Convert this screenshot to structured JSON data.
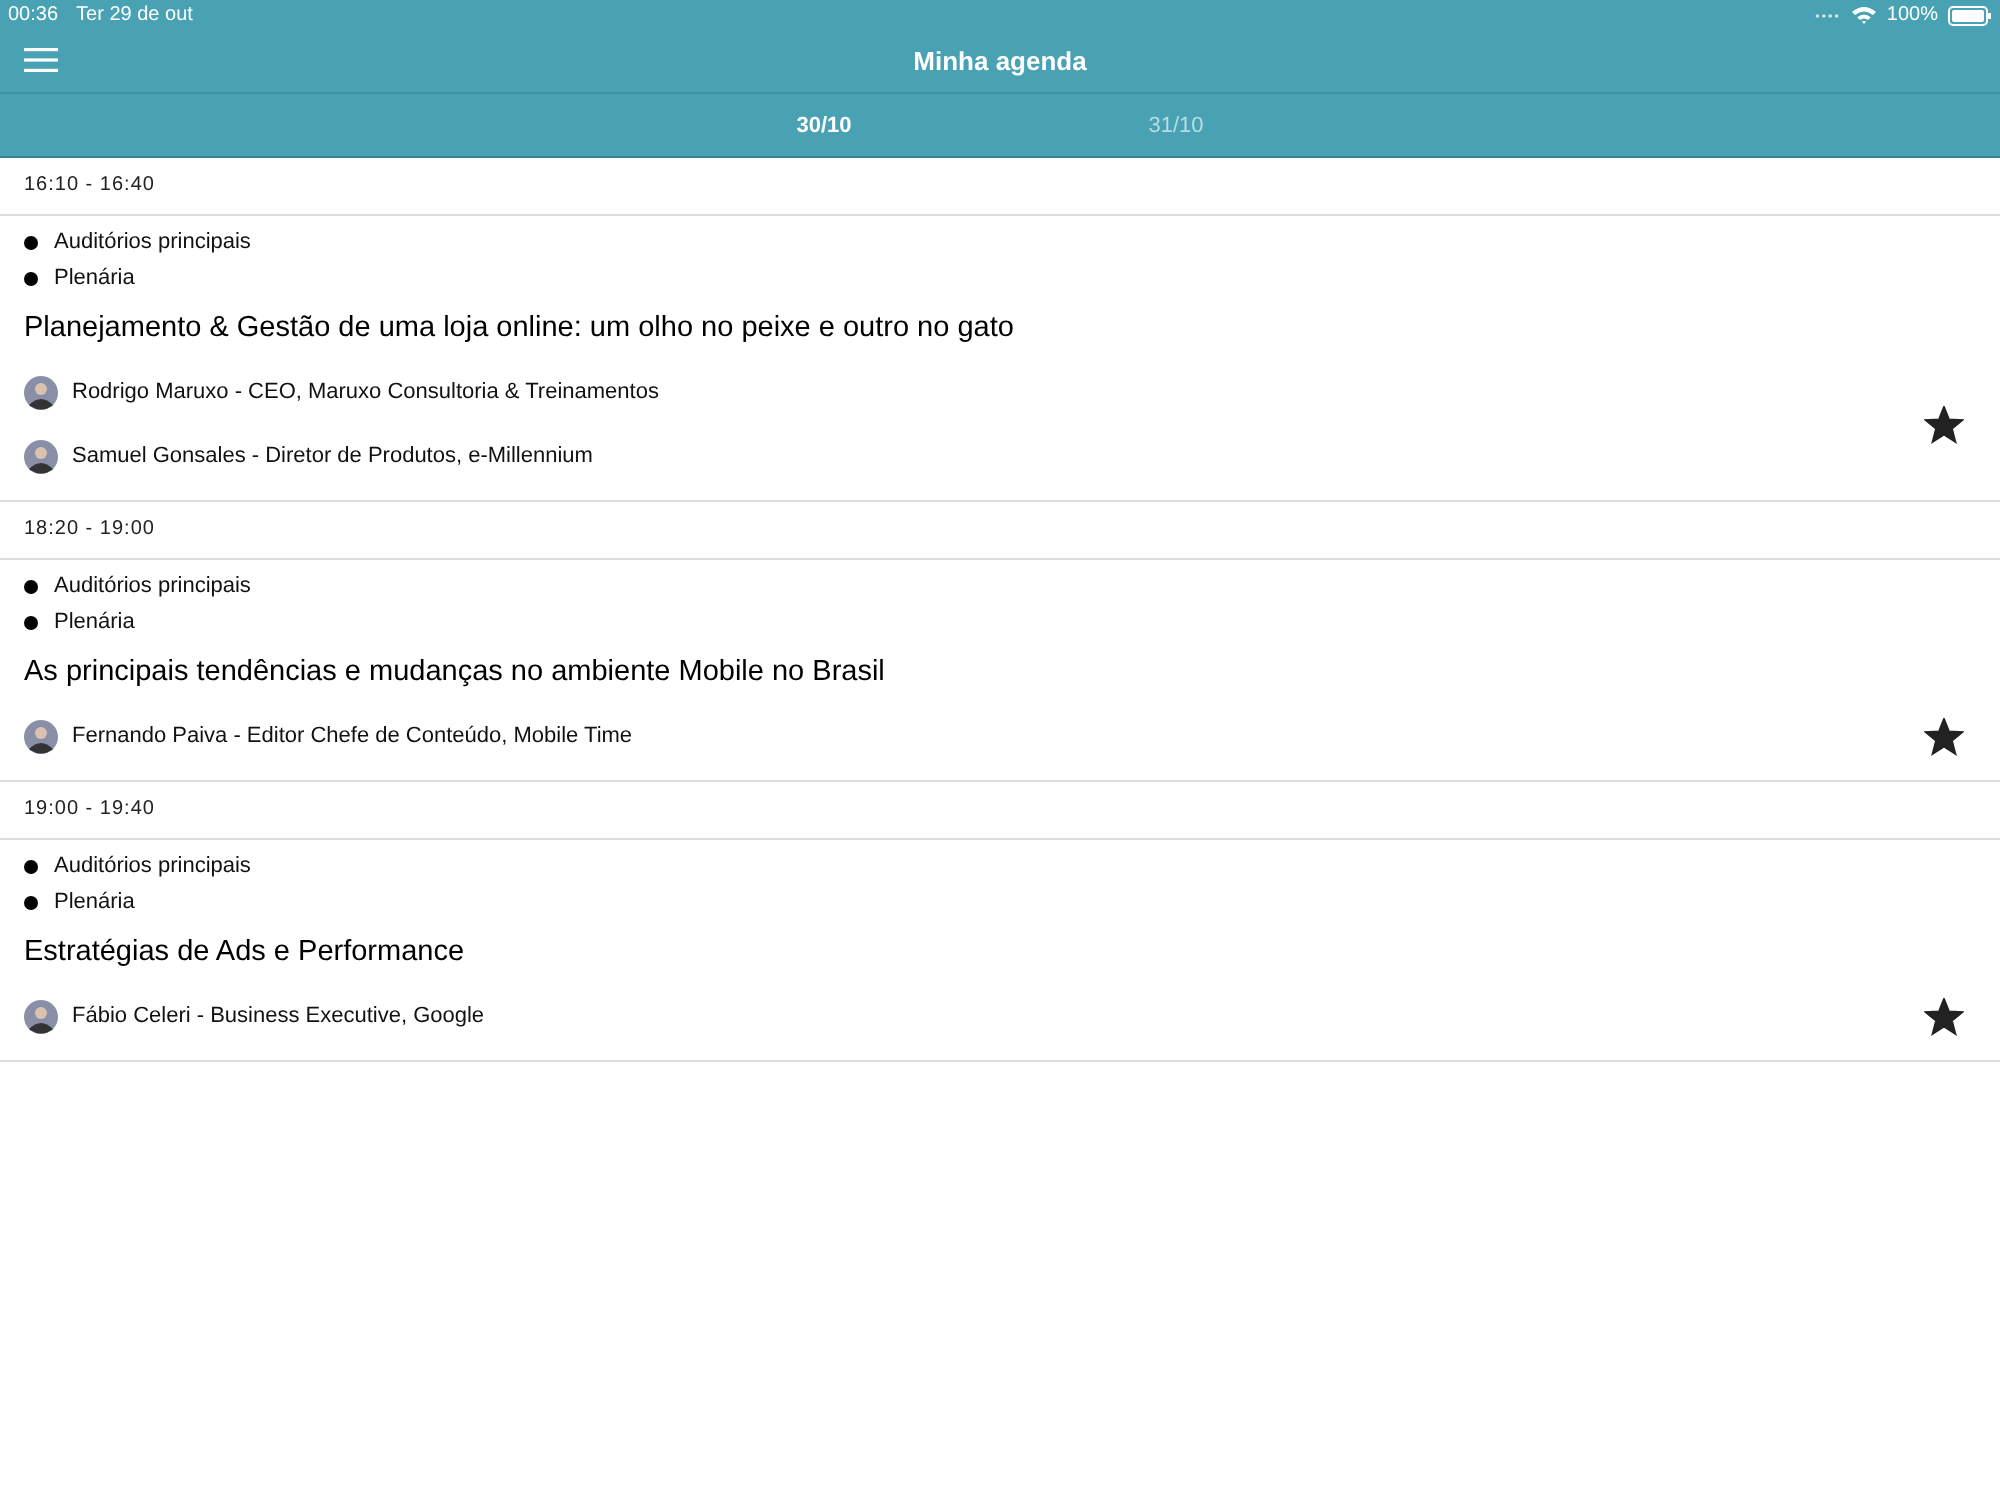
{
  "status_bar": {
    "time": "00:36",
    "date": "Ter 29 de out",
    "battery": "100%"
  },
  "nav": {
    "title": "Minha agenda"
  },
  "tabs": [
    {
      "label": "30/10",
      "selected": true
    },
    {
      "label": "31/10",
      "selected": false
    }
  ],
  "sessions": [
    {
      "time": "16:10 - 16:40",
      "places": [
        "Auditórios principais",
        "Plenária"
      ],
      "title": "Planejamento & Gestão de uma loja online: um olho no peixe e outro no gato",
      "starred": true,
      "speakers": [
        "Rodrigo Maruxo - CEO, Maruxo Consultoria & Treinamentos",
        "Samuel Gonsales - Diretor de Produtos, e-Millennium"
      ]
    },
    {
      "time": "18:20 - 19:00",
      "places": [
        "Auditórios principais",
        "Plenária"
      ],
      "title": "As principais tendências e mudanças no ambiente Mobile no Brasil",
      "starred": true,
      "speakers": [
        "Fernando Paiva - Editor Chefe de Conteúdo, Mobile Time"
      ]
    },
    {
      "time": "19:00 - 19:40",
      "places": [
        "Auditórios principais",
        "Plenária"
      ],
      "title": "Estratégias de Ads e Performance",
      "starred": true,
      "speakers": [
        "Fábio Celeri - Business Executive, Google"
      ]
    }
  ]
}
